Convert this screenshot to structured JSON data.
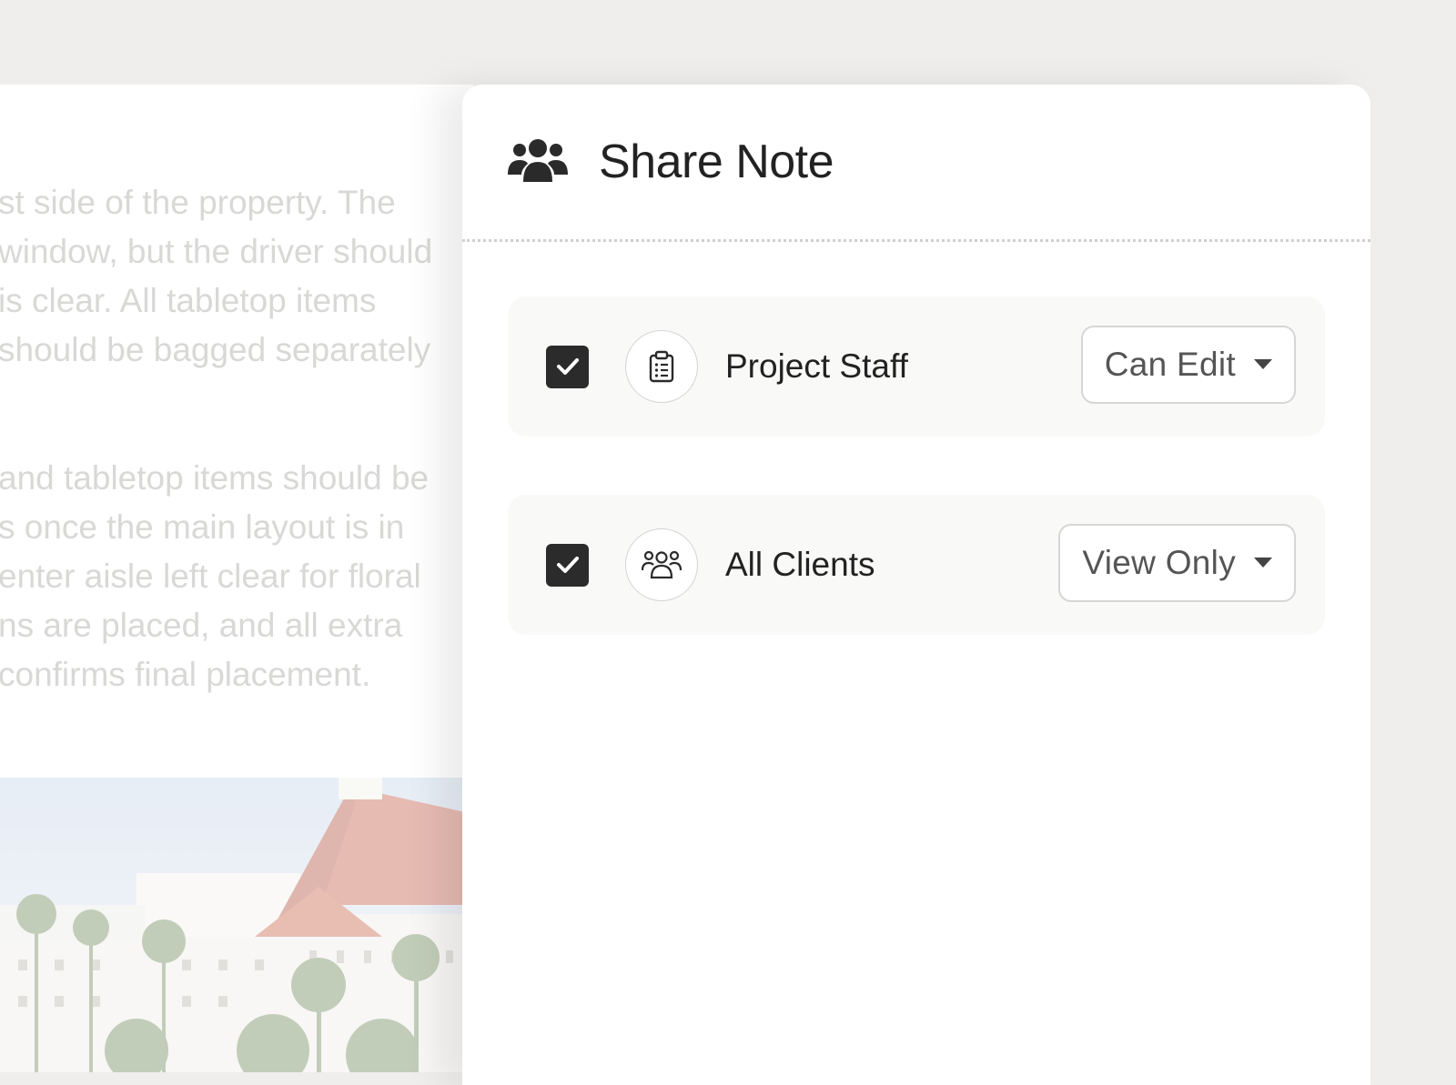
{
  "note_preview": {
    "paragraph_1": [
      "st side of the property. The",
      "window, but the driver should",
      "is clear. All tabletop items",
      "should be bagged separately"
    ],
    "paragraph_2": [
      " and tabletop items should be",
      "s once the main layout is in",
      "enter aisle left clear for floral",
      "ns are placed, and all extra",
      "confirms final placement."
    ],
    "photo_icon": "hotel-photo"
  },
  "share_panel": {
    "header_icon": "users-icon",
    "title": "Share Note",
    "entries": [
      {
        "checked": true,
        "icon": "clipboard-list-icon",
        "label": "Project Staff",
        "permission": "Can Edit"
      },
      {
        "checked": true,
        "icon": "users-group-icon",
        "label": "All Clients",
        "permission": "View Only"
      }
    ]
  },
  "colors": {
    "background": "#efeeec",
    "panel": "#ffffff",
    "row": "#f9f9f8",
    "checkbox": "#2b2b2b",
    "faded_text": "#d8d8d6"
  }
}
